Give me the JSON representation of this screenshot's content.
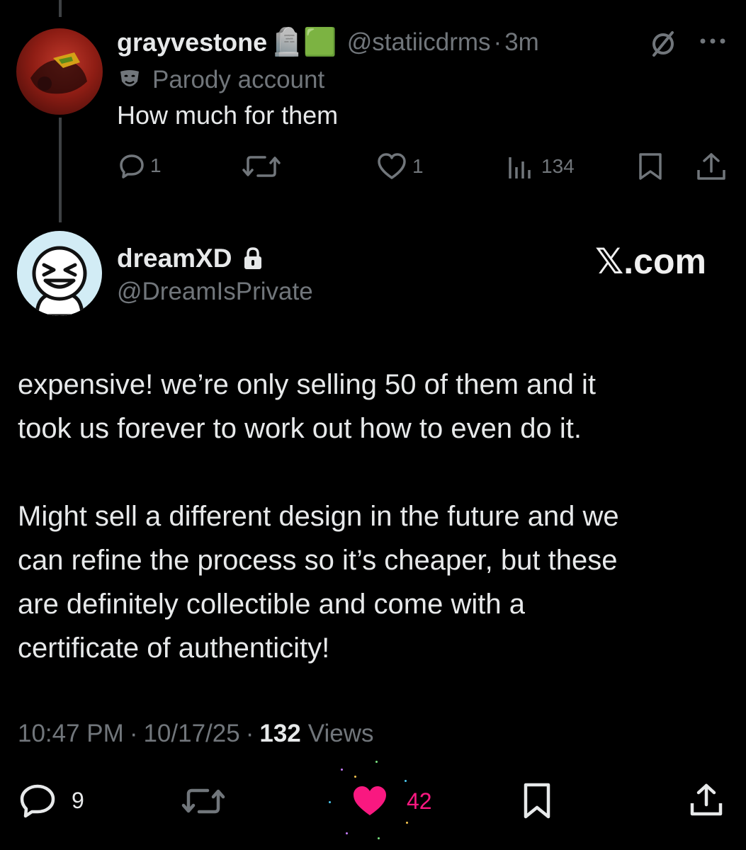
{
  "reply": {
    "display_name": "grayvestone",
    "name_emojis": "🪦🟩",
    "handle": "@statiicdrms",
    "separator": "·",
    "time": "3m",
    "label": "Parody account",
    "text": "How much for them",
    "actions": {
      "replies": "1",
      "reposts": "",
      "likes": "1",
      "views": "134"
    }
  },
  "main": {
    "display_name": "dreamXD",
    "handle": "@DreamIsPrivate",
    "watermark": "𝕏.com",
    "text": "expensive! we’re only selling 50 of them and it\ntook us forever to work out how to even do it.\n\nMight sell a different design in the future and we\ncan refine the process so it’s cheaper, but these\nare definitely collectible and come with a\ncertificate of authenticity!",
    "time": "10:47 PM",
    "date": "10/17/25",
    "separator": "·",
    "views_count": "132",
    "views_label": "Views",
    "actions": {
      "replies": "9",
      "reposts": "",
      "likes": "42"
    }
  },
  "colors": {
    "background": "#000000",
    "text": "#e7e9ea",
    "muted": "#71767b",
    "like_active": "#f91880",
    "thread_line": "#3e4144"
  },
  "icons": [
    "no-translate-icon",
    "more-icon",
    "parody-mask-icon",
    "reply-icon",
    "repost-icon",
    "like-icon",
    "views-icon",
    "bookmark-icon",
    "share-icon",
    "lock-icon"
  ]
}
